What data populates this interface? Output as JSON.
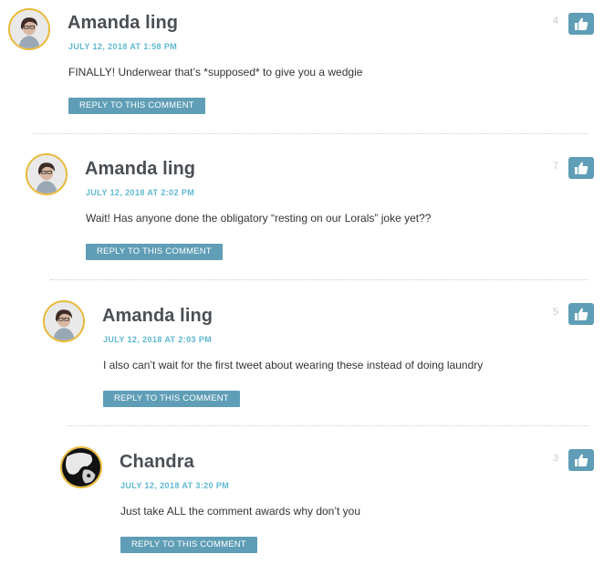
{
  "theme": {
    "accent": "#5f9eb6",
    "date_color": "#5fb8d0",
    "avatar_border": "#e8b93a"
  },
  "comments": [
    {
      "author": "Amanda ling",
      "date": "JULY 12, 2018 AT 1:58 PM",
      "text": "FINALLY! Underwear that’s *supposed* to give you a wedgie",
      "reply_label": "REPLY TO THIS COMMENT",
      "votes": "4",
      "avatar": "amanda-avatar",
      "like_icon": "thumbs-up-icon"
    },
    {
      "author": "Amanda ling",
      "date": "JULY 12, 2018 AT 2:02 PM",
      "text": "Wait! Has anyone done the obligatory “resting on our Lorals” joke yet??",
      "reply_label": "REPLY TO THIS COMMENT",
      "votes": "7",
      "avatar": "amanda-avatar",
      "like_icon": "thumbs-up-icon"
    },
    {
      "author": "Amanda ling",
      "date": "JULY 12, 2018 AT 2:03 PM",
      "text": "I also can’t wait for the first tweet about wearing these instead of doing laundry",
      "reply_label": "REPLY TO THIS COMMENT",
      "votes": "5",
      "avatar": "amanda-avatar",
      "like_icon": "thumbs-up-icon"
    },
    {
      "author": "Chandra",
      "date": "JULY 12, 2018 AT 3:20 PM",
      "text": "Just take ALL the comment awards why don’t you",
      "reply_label": "REPLY TO THIS COMMENT",
      "votes": "3",
      "avatar": "chandra-avatar",
      "like_icon": "thumbs-up-icon"
    }
  ]
}
